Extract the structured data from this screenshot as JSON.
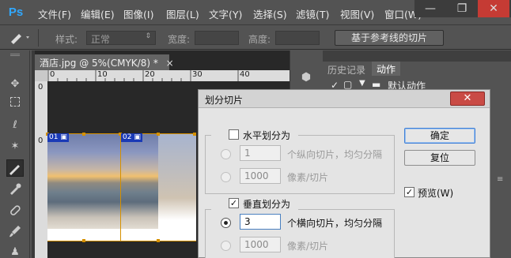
{
  "app": {
    "logo": "Ps"
  },
  "menu": [
    "文件(F)",
    "编辑(E)",
    "图像(I)",
    "图层(L)",
    "文字(Y)",
    "选择(S)",
    "滤镜(T)",
    "视图(V)",
    "窗口(W)"
  ],
  "window_controls": {
    "minimize": "—",
    "maximize": "❐",
    "close": "✕"
  },
  "options_bar": {
    "style_label": "样式:",
    "style_value": "正常",
    "width_label": "宽度:",
    "height_label": "高度:",
    "slice_from_guides": "基于参考线的切片"
  },
  "document": {
    "tab": "酒店.jpg @ 5%(CMYK/8) *",
    "ruler_top": [
      "0",
      "10",
      "20",
      "30",
      "40"
    ],
    "ruler_left": [
      "0",
      "0"
    ],
    "slice_labels": [
      "01",
      "02"
    ]
  },
  "panels": {
    "history_tab": "历史记录",
    "actions_tab": "动作",
    "default_actions": "默认动作"
  },
  "dialog": {
    "title": "划分切片",
    "horizontal": {
      "label": "水平划分为",
      "checked": false,
      "count_value": "1",
      "count_suffix": "个纵向切片，均匀分隔",
      "pixels_value": "1000",
      "pixels_suffix": "像素/切片"
    },
    "vertical": {
      "label": "垂直划分为",
      "checked": true,
      "count_value": "3",
      "count_suffix": "个横向切片，均匀分隔",
      "pixels_value": "1000",
      "pixels_suffix": "像素/切片"
    },
    "ok_button": "确定",
    "reset_button": "复位",
    "preview_label": "预览(W)",
    "preview_checked": true
  }
}
